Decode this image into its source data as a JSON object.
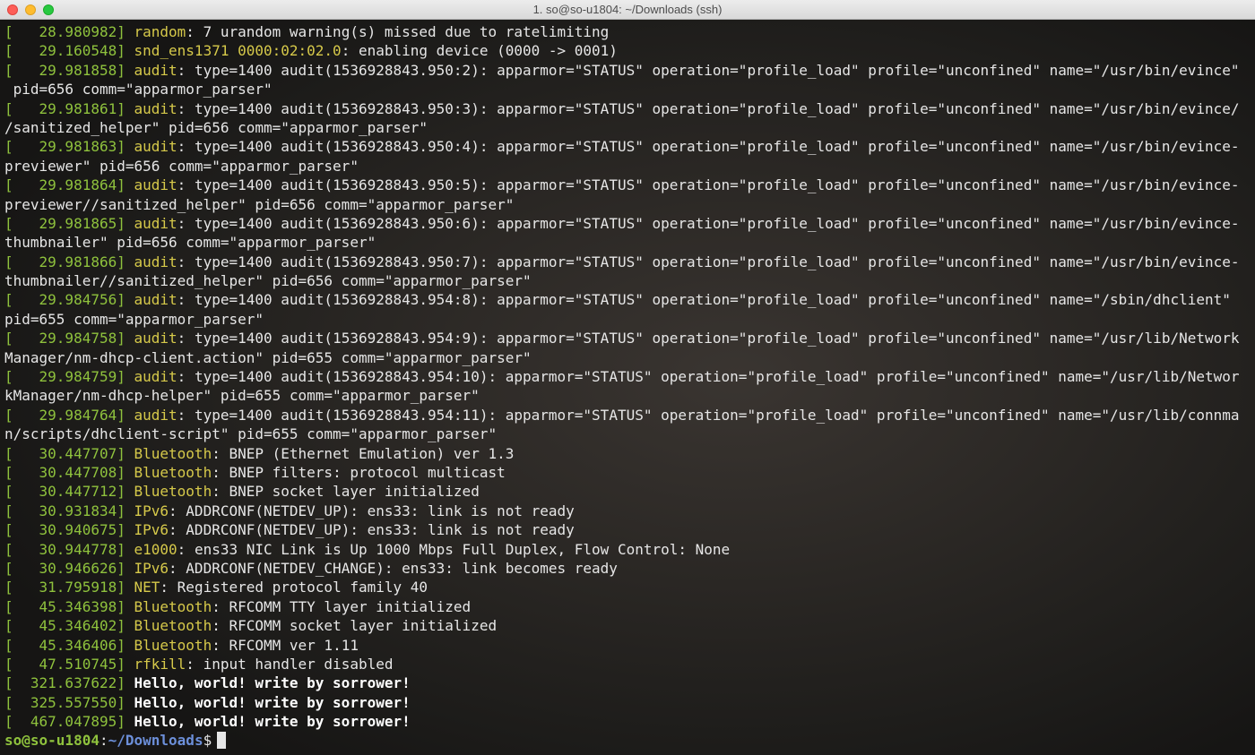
{
  "window": {
    "title": "1. so@so-u1804: ~/Downloads (ssh)"
  },
  "terminal": {
    "lines": [
      {
        "ts": "[   28.980982]",
        "src": "random",
        "msg": ": 7 urandom warning(s) missed due to ratelimiting"
      },
      {
        "ts": "[   29.160548]",
        "src": "snd_ens1371 0000:02:02.0",
        "msg": ": enabling device (0000 -> 0001)"
      },
      {
        "ts": "[   29.981858]",
        "src": "audit",
        "msg": ": type=1400 audit(1536928843.950:2): apparmor=\"STATUS\" operation=\"profile_load\" profile=\"unconfined\" name=\"/usr/bin/evince\""
      },
      {
        "ts": "",
        "src": "",
        "msg": " pid=656 comm=\"apparmor_parser\""
      },
      {
        "ts": "[   29.981861]",
        "src": "audit",
        "msg": ": type=1400 audit(1536928843.950:3): apparmor=\"STATUS\" operation=\"profile_load\" profile=\"unconfined\" name=\"/usr/bin/evince/"
      },
      {
        "ts": "",
        "src": "",
        "msg": "/sanitized_helper\" pid=656 comm=\"apparmor_parser\""
      },
      {
        "ts": "[   29.981863]",
        "src": "audit",
        "msg": ": type=1400 audit(1536928843.950:4): apparmor=\"STATUS\" operation=\"profile_load\" profile=\"unconfined\" name=\"/usr/bin/evince-"
      },
      {
        "ts": "",
        "src": "",
        "msg": "previewer\" pid=656 comm=\"apparmor_parser\""
      },
      {
        "ts": "[   29.981864]",
        "src": "audit",
        "msg": ": type=1400 audit(1536928843.950:5): apparmor=\"STATUS\" operation=\"profile_load\" profile=\"unconfined\" name=\"/usr/bin/evince-"
      },
      {
        "ts": "",
        "src": "",
        "msg": "previewer//sanitized_helper\" pid=656 comm=\"apparmor_parser\""
      },
      {
        "ts": "[   29.981865]",
        "src": "audit",
        "msg": ": type=1400 audit(1536928843.950:6): apparmor=\"STATUS\" operation=\"profile_load\" profile=\"unconfined\" name=\"/usr/bin/evince-"
      },
      {
        "ts": "",
        "src": "",
        "msg": "thumbnailer\" pid=656 comm=\"apparmor_parser\""
      },
      {
        "ts": "[   29.981866]",
        "src": "audit",
        "msg": ": type=1400 audit(1536928843.950:7): apparmor=\"STATUS\" operation=\"profile_load\" profile=\"unconfined\" name=\"/usr/bin/evince-"
      },
      {
        "ts": "",
        "src": "",
        "msg": "thumbnailer//sanitized_helper\" pid=656 comm=\"apparmor_parser\""
      },
      {
        "ts": "[   29.984756]",
        "src": "audit",
        "msg": ": type=1400 audit(1536928843.954:8): apparmor=\"STATUS\" operation=\"profile_load\" profile=\"unconfined\" name=\"/sbin/dhclient\""
      },
      {
        "ts": "",
        "src": "",
        "msg": "pid=655 comm=\"apparmor_parser\""
      },
      {
        "ts": "[   29.984758]",
        "src": "audit",
        "msg": ": type=1400 audit(1536928843.954:9): apparmor=\"STATUS\" operation=\"profile_load\" profile=\"unconfined\" name=\"/usr/lib/Network"
      },
      {
        "ts": "",
        "src": "",
        "msg": "Manager/nm-dhcp-client.action\" pid=655 comm=\"apparmor_parser\""
      },
      {
        "ts": "[   29.984759]",
        "src": "audit",
        "msg": ": type=1400 audit(1536928843.954:10): apparmor=\"STATUS\" operation=\"profile_load\" profile=\"unconfined\" name=\"/usr/lib/Networ"
      },
      {
        "ts": "",
        "src": "",
        "msg": "kManager/nm-dhcp-helper\" pid=655 comm=\"apparmor_parser\""
      },
      {
        "ts": "[   29.984764]",
        "src": "audit",
        "msg": ": type=1400 audit(1536928843.954:11): apparmor=\"STATUS\" operation=\"profile_load\" profile=\"unconfined\" name=\"/usr/lib/connma"
      },
      {
        "ts": "",
        "src": "",
        "msg": "n/scripts/dhclient-script\" pid=655 comm=\"apparmor_parser\""
      },
      {
        "ts": "[   30.447707]",
        "src": "Bluetooth",
        "msg": ": BNEP (Ethernet Emulation) ver 1.3"
      },
      {
        "ts": "[   30.447708]",
        "src": "Bluetooth",
        "msg": ": BNEP filters: protocol multicast"
      },
      {
        "ts": "[   30.447712]",
        "src": "Bluetooth",
        "msg": ": BNEP socket layer initialized"
      },
      {
        "ts": "[   30.931834]",
        "src": "IPv6",
        "msg": ": ADDRCONF(NETDEV_UP): ens33: link is not ready"
      },
      {
        "ts": "[   30.940675]",
        "src": "IPv6",
        "msg": ": ADDRCONF(NETDEV_UP): ens33: link is not ready"
      },
      {
        "ts": "[   30.944778]",
        "src": "e1000",
        "msg": ": ens33 NIC Link is Up 1000 Mbps Full Duplex, Flow Control: None"
      },
      {
        "ts": "[   30.946626]",
        "src": "IPv6",
        "msg": ": ADDRCONF(NETDEV_CHANGE): ens33: link becomes ready"
      },
      {
        "ts": "[   31.795918]",
        "src": "NET",
        "msg": ": Registered protocol family 40"
      },
      {
        "ts": "[   45.346398]",
        "src": "Bluetooth",
        "msg": ": RFCOMM TTY layer initialized"
      },
      {
        "ts": "[   45.346402]",
        "src": "Bluetooth",
        "msg": ": RFCOMM socket layer initialized"
      },
      {
        "ts": "[   45.346406]",
        "src": "Bluetooth",
        "msg": ": RFCOMM ver 1.11"
      },
      {
        "ts": "[   47.510745]",
        "src": "rfkill",
        "msg": ": input handler disabled"
      },
      {
        "ts": "[  321.637622]",
        "src": "",
        "msg": " Hello, world! write by sorrower!",
        "bold": true
      },
      {
        "ts": "[  325.557550]",
        "src": "",
        "msg": " Hello, world! write by sorrower!",
        "bold": true
      },
      {
        "ts": "[  467.047895]",
        "src": "",
        "msg": " Hello, world! write by sorrower!",
        "bold": true
      }
    ],
    "prompt": {
      "user_host": "so@so-u1804",
      "separator": ":",
      "path": "~/Downloads",
      "symbol": "$"
    }
  },
  "colors": {
    "timestamp": "#8fc23d",
    "source": "#d6c94a",
    "text": "#e6e6e6",
    "prompt_user": "#8fc23d",
    "prompt_path": "#6c8fd9"
  }
}
